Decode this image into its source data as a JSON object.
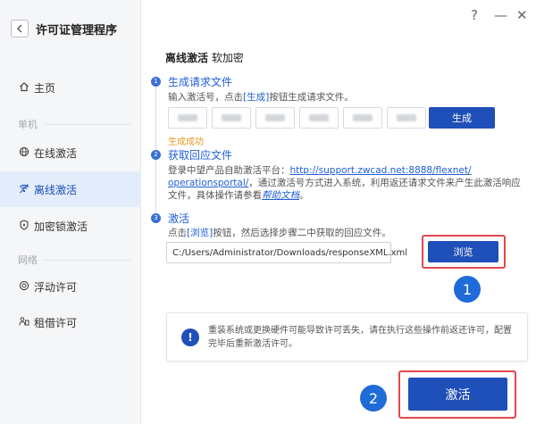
{
  "app": {
    "title": "许可证管理程序",
    "back_icon": "chevron-left-icon",
    "help_glyph": "?",
    "minimize_glyph": "—",
    "close_glyph": "✕"
  },
  "sidebar": {
    "home": {
      "label": "主页",
      "icon": "home-icon"
    },
    "group_standalone": "单机",
    "online": {
      "label": "在线激活",
      "icon": "globe-icon"
    },
    "offline": {
      "label": "离线激活",
      "icon": "wifi-icon"
    },
    "dongle": {
      "label": "加密锁激活",
      "icon": "shield-icon"
    },
    "group_network": "网络",
    "floating": {
      "label": "浮动许可",
      "icon": "floating-icon"
    },
    "borrow": {
      "label": "租借许可",
      "icon": "borrow-icon"
    }
  },
  "main": {
    "title_bold": "离线激活",
    "title_rest": "软加密",
    "step1": {
      "num": "1",
      "title": "生成请求文件",
      "desc_a": "输入激活号，点击",
      "desc_link": "[生成]",
      "desc_b": "按钮生成请求文件。",
      "generate_label": "生成",
      "success": "生成成功"
    },
    "step2": {
      "num": "2",
      "title": "获取回应文件",
      "para_a": "登录中望产品自助激活平台：",
      "url_line1": "http://support.zwcad.net:8888/flexnet/",
      "url_line2": "operationsportal/",
      "para_b": "，通过激活号方式进入系统，利用返还请求文件来产生此激活响应文件，具体操作请参看",
      "help_link": "帮助文档",
      "para_end": "。"
    },
    "step3": {
      "num": "3",
      "title": "激活",
      "desc_a": "点击",
      "desc_link": "[浏览]",
      "desc_b": "按钮，然后选择步骤二中获取的回应文件。",
      "path_value": "C:/Users/Administrator/Downloads/responseXML.xml",
      "browse_label": "浏览"
    },
    "notice_text": "重装系统或更换硬件可能导致许可丢失，请在执行这些操作前返还许可，配置完毕后重新激活许可。",
    "notice_glyph": "!",
    "activate_label": "激活"
  },
  "callouts": {
    "one": "1",
    "two": "2"
  },
  "colors": {
    "accent": "#1f4fb8",
    "link": "#1f5fd6",
    "success": "#e39b20",
    "highlight_frame": "#e4474f",
    "callout": "#1f6bd8"
  }
}
